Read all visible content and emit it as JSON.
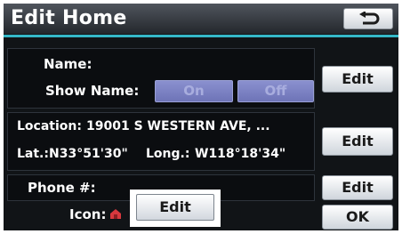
{
  "header": {
    "title": "Edit Home",
    "back_icon": "back-arrow-icon"
  },
  "name_row": {
    "name_label": "Name:",
    "show_name_label": "Show Name:",
    "on_label": "On",
    "off_label": "Off"
  },
  "location_row": {
    "location_label": "Location:",
    "location_value": "19001 S WESTERN AVE, ...",
    "lat_label": "Lat.:",
    "lat_value": "N33°51'30\"",
    "long_label": "Long.:",
    "long_value": "W118°18'34\""
  },
  "phone_row": {
    "label": "Phone #:"
  },
  "icon_row": {
    "label": "Icon:",
    "icon": "home-marker-icon",
    "edit_label": "Edit"
  },
  "buttons": {
    "edit_name": "Edit",
    "edit_location": "Edit",
    "edit_phone": "Edit",
    "ok": "OK"
  },
  "colors": {
    "accent": "#35b8c8",
    "toggle": "#7b81c4",
    "background": "#111417"
  }
}
